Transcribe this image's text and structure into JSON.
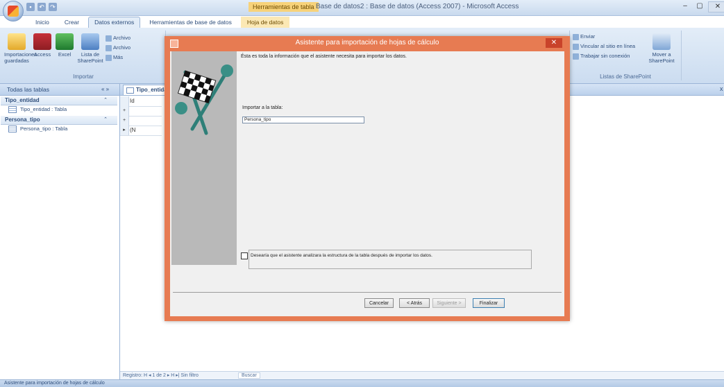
{
  "window": {
    "title": "Base de datos2 : Base de datos (Access 2007) - Microsoft Access",
    "contextual_tab_title": "Herramientas de tabla",
    "controls": [
      "–",
      "▢",
      "✕"
    ]
  },
  "quick_access": [
    "save-icon",
    "undo-icon",
    "redo-icon"
  ],
  "ribbon": {
    "tabs": [
      "Inicio",
      "Crear",
      "Datos externos",
      "Herramientas de base de datos",
      "Hoja de datos"
    ],
    "active_tab_index": 2,
    "groups": {
      "import": {
        "label": "Importar",
        "buttons": [
          "Importaciones guardadas",
          "Access",
          "Excel",
          "Lista de SharePoint"
        ],
        "small": [
          "Archivo",
          "Archivo",
          "Más"
        ]
      },
      "right": {
        "small": [
          "Enviar",
          "Vincular al sitio en línea",
          "Trabajar sin conexión"
        ],
        "button": "Mover a SharePoint",
        "label": "Listas de SharePoint"
      }
    }
  },
  "nav": {
    "header": "Todas las tablas",
    "chevrons": "« »",
    "groups": [
      {
        "name": "Tipo_entidad",
        "item": "Tipo_entidad : Tabla"
      },
      {
        "name": "Persona_tipo",
        "item": "Persona_tipo : Tabla"
      }
    ]
  },
  "document": {
    "tab": "Tipo_entidad",
    "close": "x",
    "rows": [
      {
        "sel": "",
        "cell": "Id"
      },
      {
        "sel": "+",
        "cell": ""
      },
      {
        "sel": "+",
        "cell": ""
      },
      {
        "sel": "▸",
        "cell": "(N"
      }
    ]
  },
  "record_nav": {
    "text": "Registro: H  ◂  1 de 2  ▸  H  ▸|   Sin filtro",
    "search": "Buscar"
  },
  "status": {
    "text": "Asistente para importación de hojas de cálculo"
  },
  "dialog": {
    "title": "Asistente para importación de hojas de cálculo",
    "close": "✕",
    "intro": "Ésta es toda la información que el asistente necesita para importar los datos.",
    "import_label": "Importar a la tabla:",
    "table_name": "Persona_tipo",
    "analyze_text": "Desearía que el asistente analizara la estructura de la tabla después de importar los datos.",
    "analyze_checked": false,
    "buttons": {
      "cancel": "Cancelar",
      "back": "< Atrás",
      "next": "Siguiente >",
      "finish": "Finalizar"
    },
    "accent": "#e77b52"
  }
}
